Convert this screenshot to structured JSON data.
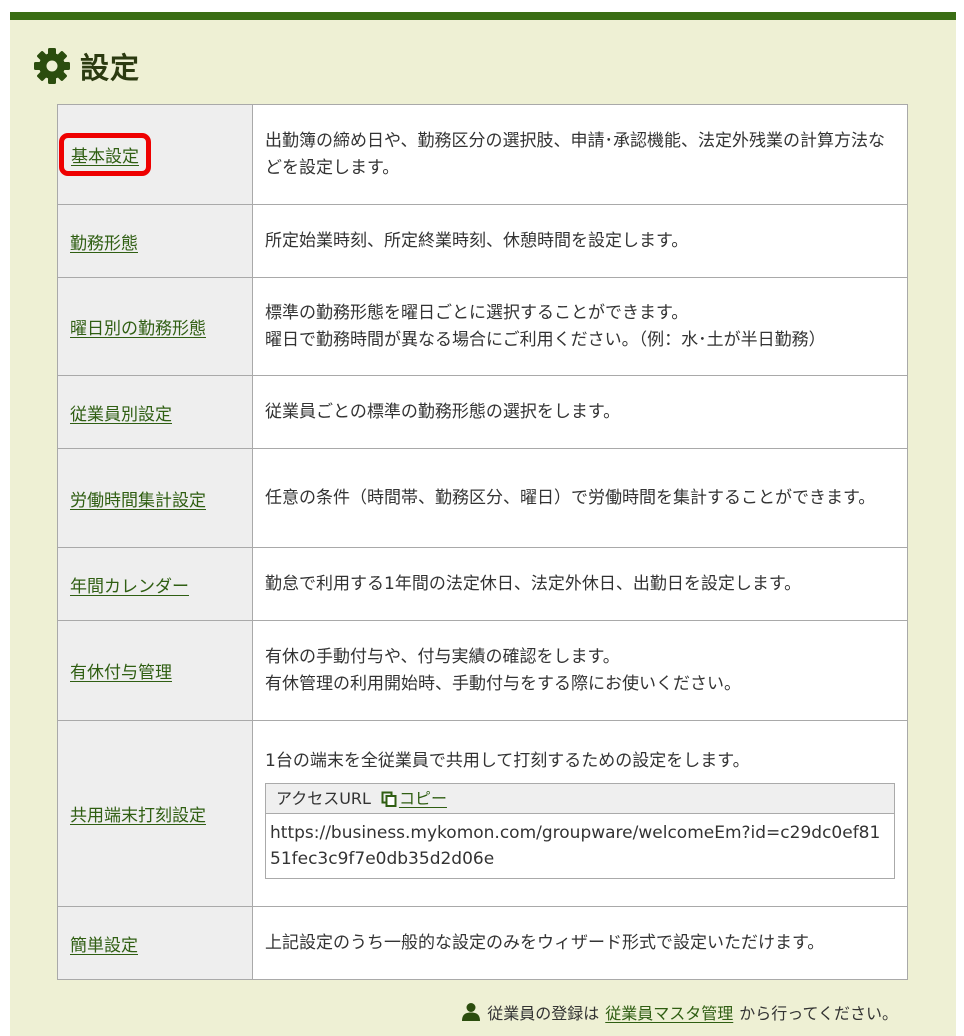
{
  "header": {
    "title": "設定",
    "icon": "gear-icon"
  },
  "colors": {
    "accent_green": "#3a6d14",
    "link_green": "#2f5e12",
    "highlight_red": "#ee0000",
    "panel_bg": "#eef0d4"
  },
  "settings": [
    {
      "label": "基本設定",
      "desc": "出勤簿の締め日や、勤務区分の選択肢、申請･承認機能、法定外残業の計算方法などを設定します。",
      "highlighted": true
    },
    {
      "label": "勤務形態",
      "desc": "所定始業時刻、所定終業時刻、休憩時間を設定します。"
    },
    {
      "label": "曜日別の勤務形態",
      "desc_lines": [
        "標準の勤務形態を曜日ごとに選択することができます。",
        "曜日で勤務時間が異なる場合にご利用ください。（例：水･土が半日勤務）"
      ]
    },
    {
      "label": "従業員別設定",
      "desc": "従業員ごとの標準の勤務形態の選択をします。"
    },
    {
      "label": "労働時間集計設定",
      "desc": "任意の条件（時間帯、勤務区分、曜日）で労働時間を集計することができます。"
    },
    {
      "label": "年間カレンダー",
      "desc": "勤怠で利用する1年間の法定休日、法定外休日、出勤日を設定します。"
    },
    {
      "label": "有休付与管理",
      "desc_lines": [
        "有休の手動付与や、付与実績の確認をします。",
        "有休管理の利用開始時、手動付与をする際にお使いください。"
      ]
    },
    {
      "label": "共用端末打刻設定",
      "desc": "1台の端末を全従業員で共用して打刻するための設定をします。",
      "access_url": {
        "header_label": "アクセスURL",
        "copy_label": "コピー",
        "copy_icon": "copy-icon",
        "value": "https://business.mykomon.com/groupware/welcomeEm?id=c29dc0ef8151fec3c9f7e0db35d2d06e"
      }
    },
    {
      "label": "簡単設定",
      "desc": "上記設定のうち一般的な設定のみをウィザード形式で設定いただけます。"
    }
  ],
  "footer": {
    "icon": "person-icon",
    "prefix": "従業員の登録は",
    "link_label": "従業員マスタ管理",
    "suffix": "から行ってください。"
  }
}
